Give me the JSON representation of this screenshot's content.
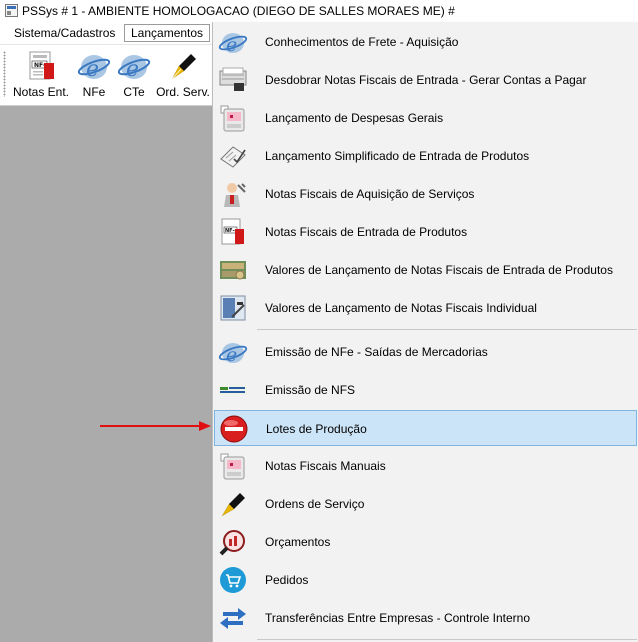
{
  "window": {
    "title": "PSSys # 1 - AMBIENTE HOMOLOGACAO (DIEGO DE SALLES MORAES ME) #"
  },
  "menubar": [
    {
      "label": "Sistema/Cadastros",
      "active": false
    },
    {
      "label": "Lançamentos",
      "active": true
    }
  ],
  "toolbar": [
    {
      "label": "Notas Ent.",
      "icon": "nfe-document-icon"
    },
    {
      "label": "NFe",
      "icon": "e-globe-icon"
    },
    {
      "label": "CTe",
      "icon": "e-globe-icon"
    },
    {
      "label": "Ord. Serv.",
      "icon": "pen-nib-icon"
    }
  ],
  "dropdown": {
    "items": [
      {
        "label": "Conhecimentos de Frete - Aquisição",
        "icon": "e-globe-icon"
      },
      {
        "label": "Desdobrar Notas Fiscais de Entrada - Gerar Contas a Pagar",
        "icon": "printer-icon"
      },
      {
        "label": "Lançamento de Despesas Gerais",
        "icon": "cash-register-icon"
      },
      {
        "label": "Lançamento Simplificado de Entrada de Produtos",
        "icon": "clipboard-check-icon"
      },
      {
        "label": "Notas Fiscais de Aquisição de Serviços",
        "icon": "technician-icon"
      },
      {
        "label": "Notas Fiscais de Entrada de Produtos",
        "icon": "nfe-document-icon"
      },
      {
        "label": "Valores de Lançamento de Notas Fiscais de Entrada de Produtos",
        "icon": "money-stack-icon"
      },
      {
        "label": "Valores de Lançamento de Notas Fiscais Individual",
        "icon": "calculator-icon"
      },
      {
        "label": "Emissão de NFe - Saídas de Mercadorias",
        "icon": "e-globe-icon"
      },
      {
        "label": "Emissão de NFS",
        "icon": "nfs-logo-icon"
      },
      {
        "label": "Lotes de Produção",
        "icon": "no-entry-icon",
        "highlighted": true
      },
      {
        "label": "Notas Fiscais Manuais",
        "icon": "cash-register-icon"
      },
      {
        "label": "Ordens de Serviço",
        "icon": "pen-nib-icon"
      },
      {
        "label": "Orçamentos",
        "icon": "magnifier-chart-icon"
      },
      {
        "label": "Pedidos",
        "icon": "shopping-cart-icon"
      },
      {
        "label": "Transferências Entre Empresas - Controle Interno",
        "icon": "transfer-arrows-icon"
      }
    ]
  },
  "colors": {
    "highlight_bg": "#cce4f7",
    "highlight_border": "#7fb4e0",
    "arrow": "#e01010",
    "workspace": "#ababab"
  }
}
